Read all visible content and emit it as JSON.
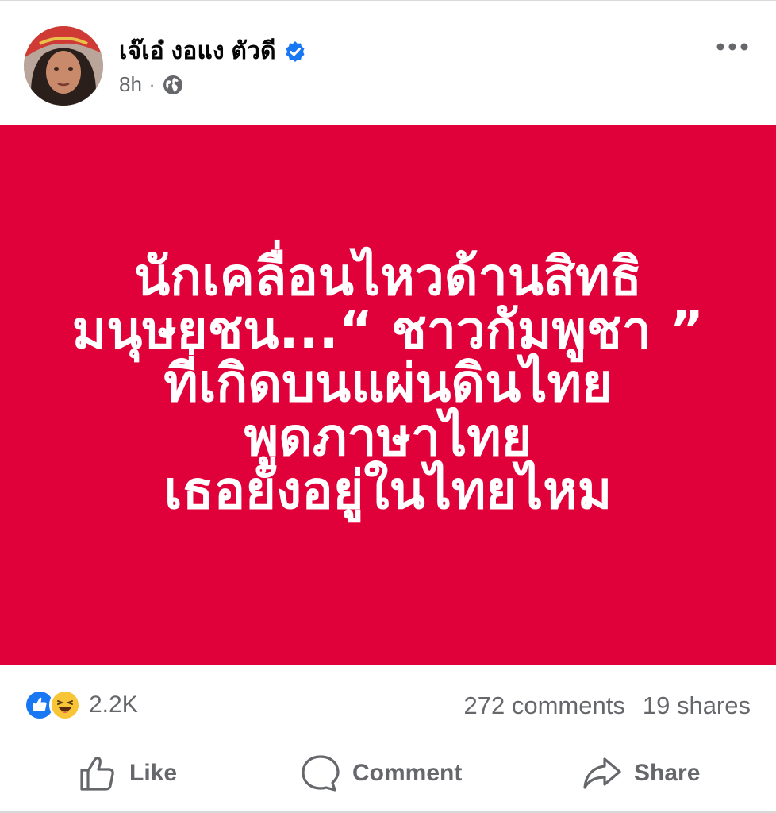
{
  "author": {
    "name": "เจ๊เอ๋ งอแง ตัวดี",
    "verified": true
  },
  "meta": {
    "time": "8h",
    "separator": "·",
    "audience_icon": "globe-icon"
  },
  "post": {
    "image_background": "#e0003a",
    "image_text": "นักเคลื่อนไหวด้านสิทธิ\nมนุษยชน...“ ชาวกัมพูชา ”\nที่เกิดบนแผ่นดินไทย\nพูดภาษาไทย\nเธอยังอยู่ในไทยไหม"
  },
  "stats": {
    "reactions": [
      "like-reaction-icon",
      "haha-reaction-icon"
    ],
    "reaction_count": "2.2K",
    "comments": "272 comments",
    "shares": "19 shares"
  },
  "actions": {
    "like": "Like",
    "comment": "Comment",
    "share": "Share"
  },
  "colors": {
    "accent_blue": "#1877f2",
    "muted_text": "#65676b",
    "banner_red": "#e0003a"
  }
}
